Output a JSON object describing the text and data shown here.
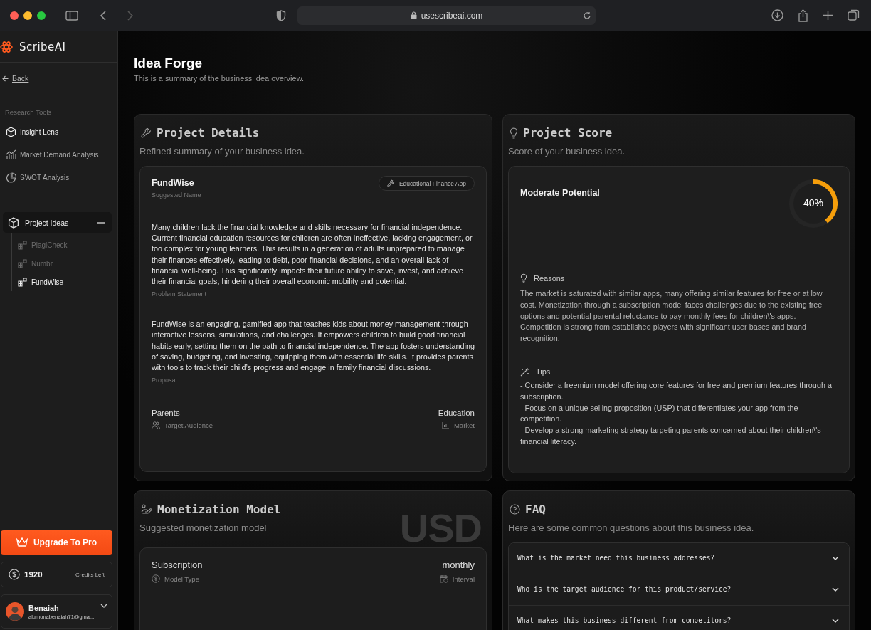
{
  "browser": {
    "url": "usescribeai.com"
  },
  "sidebar": {
    "brand": "ScribeAI",
    "back": "Back",
    "section_title": "Research Tools",
    "tools": [
      {
        "label": "Insight Lens",
        "selected": true
      },
      {
        "label": "Market Demand Analysis",
        "selected": false
      },
      {
        "label": "SWOT Analysis",
        "selected": false
      }
    ],
    "project_ideas": {
      "label": "Project Ideas",
      "expanded": true,
      "children": [
        {
          "label": "PlagiCheck",
          "selected": false
        },
        {
          "label": "Numbr",
          "selected": false
        },
        {
          "label": "FundWise",
          "selected": true
        }
      ]
    },
    "upgrade_button": "Upgrade To Pro",
    "credits": {
      "value": "1920",
      "label": "Credits Left"
    },
    "user": {
      "name": "Benaiah",
      "email": "alumonabenaiah71@gma..."
    }
  },
  "page": {
    "title": "Idea Forge",
    "subtitle": "This is a summary of the business idea overview."
  },
  "project_details": {
    "title": "Project Details",
    "subtitle": "Refined summary of your business idea.",
    "name": "FundWise",
    "name_label": "Suggested Name",
    "tag": "Educational Finance App",
    "problem": "Many children lack the financial knowledge and skills necessary for financial independence. Current financial education resources for children are often ineffective, lacking engagement, or too complex for young learners. This results in a generation of adults unprepared to manage their finances effectively, leading to debt, poor financial decisions, and an overall lack of financial well-being. This significantly impacts their future ability to save, invest, and achieve their financial goals, hindering their overall economic mobility and potential.",
    "problem_label": "Problem Statement",
    "proposal": "FundWise is an engaging, gamified app that teaches kids about money management through interactive lessons, simulations, and challenges. It empowers children to build good financial habits early, setting them on the path to financial independence. The app fosters understanding of saving, budgeting, and investing, equipping them with essential life skills. It provides parents with tools to track their child’s progress and engage in family financial discussions.",
    "proposal_label": "Proposal",
    "audience": "Parents",
    "audience_label": "Target Audience",
    "market": "Education",
    "market_label": "Market"
  },
  "project_score": {
    "title": "Project Score",
    "subtitle": "Score of your business idea.",
    "rating": "Moderate Potential",
    "level": 0.4,
    "reading": "40%",
    "reasons_title": "Reasons",
    "reasons": "The market is saturated with similar apps, many offering similar features for free or at low cost. Monetization through a subscription model faces challenges due to the existing free options and potential parental reluctance to pay monthly fees for children\\'s apps. Competition is strong from established players with significant user bases and brand recognition.",
    "tips_title": "Tips",
    "tips": [
      "- Consider a freemium model offering core features for free and premium features through a subscription.",
      "- Focus on a unique selling proposition (USP) that differentiates your app from the competition.",
      "- Develop a strong marketing strategy targeting parents concerned about their children\\'s financial literacy."
    ]
  },
  "monetization": {
    "title": "Monetization Model",
    "subtitle": "Suggested monetization model",
    "currency": "USD",
    "model": "Subscription",
    "model_label": "Model Type",
    "interval": "monthly",
    "interval_label": "Interval"
  },
  "faq": {
    "title": "FAQ",
    "subtitle": "Here are some common questions about this business idea.",
    "items": [
      {
        "question": "What is the market need this business addresses?",
        "expanded": false
      },
      {
        "question": "Who is the target audience for this product/service?",
        "expanded": false
      },
      {
        "question": "What makes this business different from competitors?",
        "expanded": false
      }
    ]
  }
}
